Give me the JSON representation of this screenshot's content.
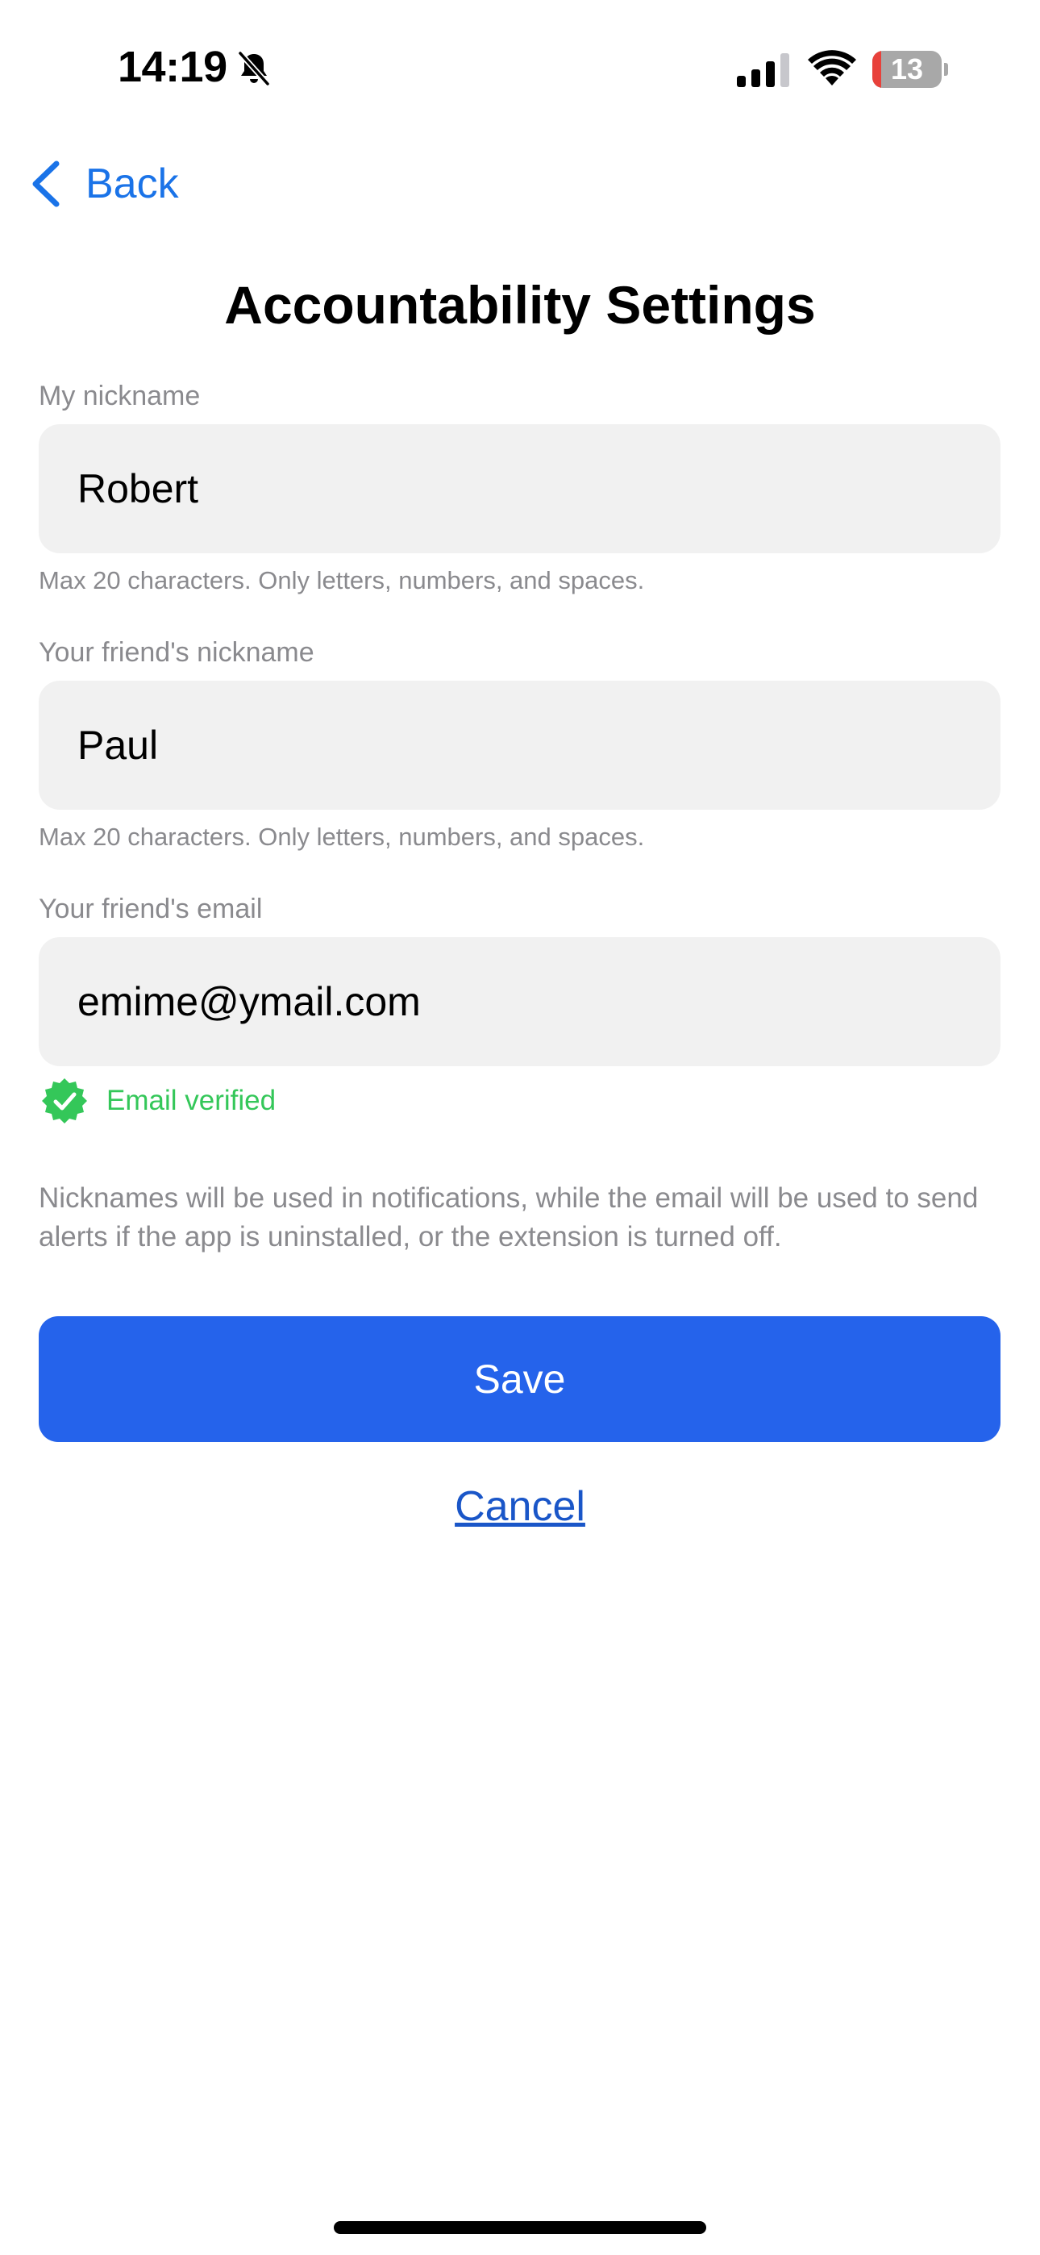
{
  "status_bar": {
    "time": "14:19",
    "battery_percent": "13",
    "battery_level": 0.13,
    "icons": [
      "bell-slash-icon",
      "signal-icon",
      "wifi-icon",
      "battery-icon"
    ]
  },
  "nav": {
    "back_label": "Back",
    "back_icon": "chevron-left-icon"
  },
  "title": "Accountability Settings",
  "form": {
    "my_nickname": {
      "label": "My nickname",
      "value": "Robert",
      "hint": "Max 20 characters. Only letters, numbers, and spaces."
    },
    "friend_nickname": {
      "label": "Your friend's nickname",
      "value": "Paul",
      "hint": "Max 20 characters. Only letters, numbers, and spaces."
    },
    "friend_email": {
      "label": "Your friend's email",
      "value": "emime@ymail.com"
    },
    "verified": {
      "text": "Email verified",
      "icon": "verified-badge-icon"
    },
    "info": "Nicknames will be used in notifications, while the email will be used to send alerts if the app is uninstalled, or the extension is turned off."
  },
  "actions": {
    "save_label": "Save",
    "cancel_label": "Cancel"
  },
  "colors": {
    "accent": "#2563eb",
    "link": "#1a73e8",
    "success": "#34c759",
    "battery_low": "#e8413b"
  }
}
